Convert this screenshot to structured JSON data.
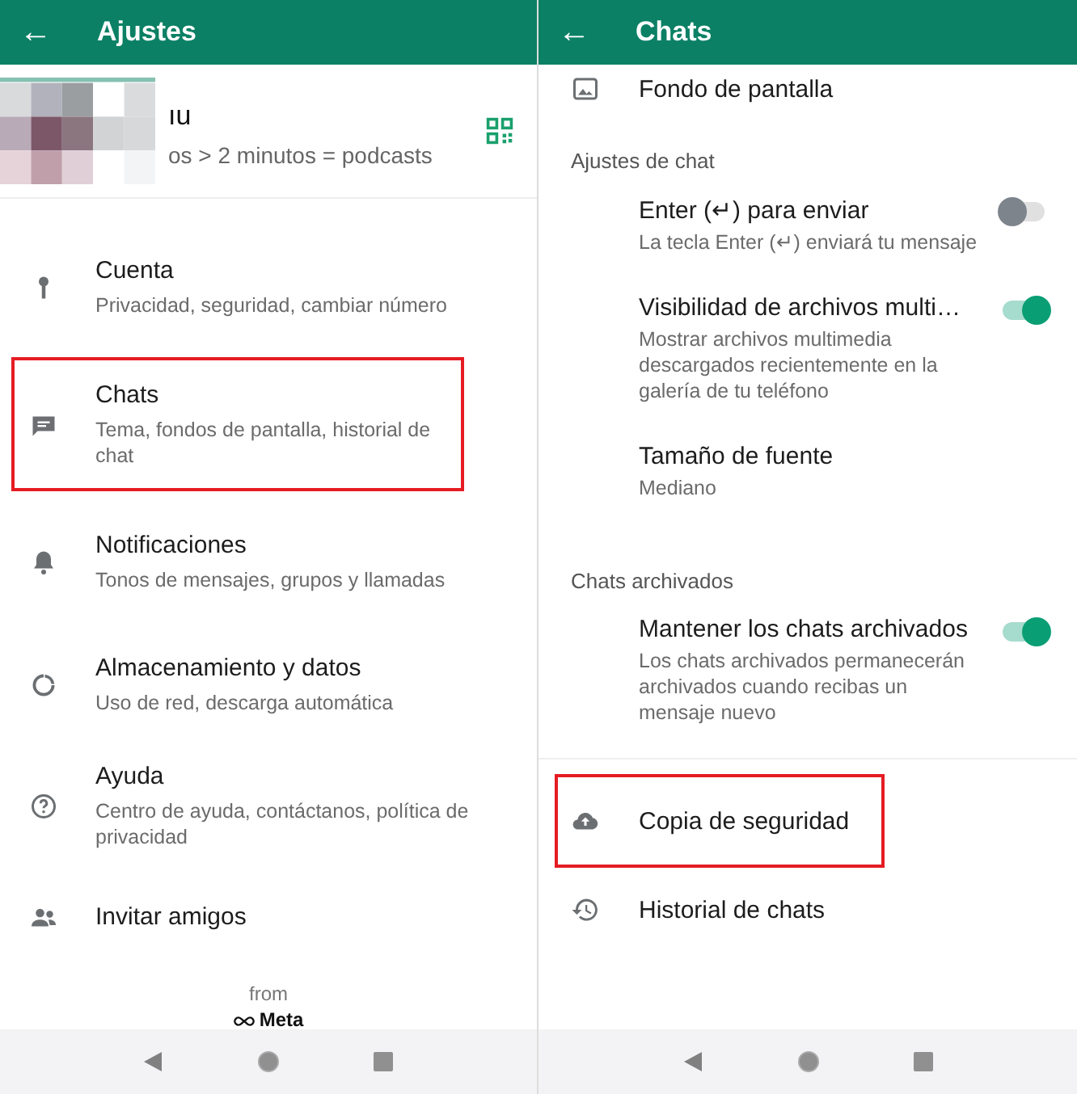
{
  "settings": {
    "title": "Ajustes",
    "back": "←",
    "profile": {
      "kind": "picture",
      "name": "ıu",
      "status": "os > 2 minutos = podcasts"
    },
    "items": [
      {
        "title": "Cuenta",
        "subtitle": "Privacidad, seguridad, cambiar número",
        "highlighted": false
      },
      {
        "title": "Chats",
        "subtitle": "Tema, fondos de pantalla, historial de chat",
        "highlighted": true
      },
      {
        "title": "Notificaciones",
        "subtitle": "Tonos de mensajes, grupos y llamadas",
        "highlighted": false
      },
      {
        "title": "Almacenamiento y datos",
        "subtitle": "Uso de red, descarga automática",
        "highlighted": false
      },
      {
        "title": "Ayuda",
        "subtitle": "Centro de ayuda, contáctanos, política de privacidad",
        "highlighted": false
      },
      {
        "title": "Invitar amigos",
        "highlighted": false
      }
    ],
    "footer": {
      "from": "from",
      "brand": "Meta"
    }
  },
  "chats": {
    "title": "Chats",
    "back": "←",
    "top_item": {
      "title": "Fondo de pantalla"
    },
    "sections": [
      {
        "header": "Ajustes de chat",
        "items": [
          {
            "kind": "toggle",
            "title": "Enter (↵) para enviar",
            "subtitle": "La tecla Enter (↵) enviará tu mensaje",
            "on": false
          },
          {
            "kind": "toggle",
            "title": "Visibilidad de archivos multi…",
            "subtitle": "Mostrar archivos multimedia descargados recientemente en la galería de tu teléfono",
            "on": true
          },
          {
            "kind": "text",
            "title": "Tamaño de fuente",
            "subtitle": "Mediano"
          }
        ]
      },
      {
        "header": "Chats archivados",
        "items": [
          {
            "kind": "toggle",
            "title": "Mantener los chats archivados",
            "subtitle": "Los chats archivados permanecerán archivados cuando recibas un mensaje nuevo",
            "on": true
          }
        ]
      }
    ],
    "bottom_items": [
      {
        "title": "Copia de seguridad",
        "highlighted": true
      },
      {
        "title": "Historial de chats",
        "highlighted": false
      }
    ]
  }
}
